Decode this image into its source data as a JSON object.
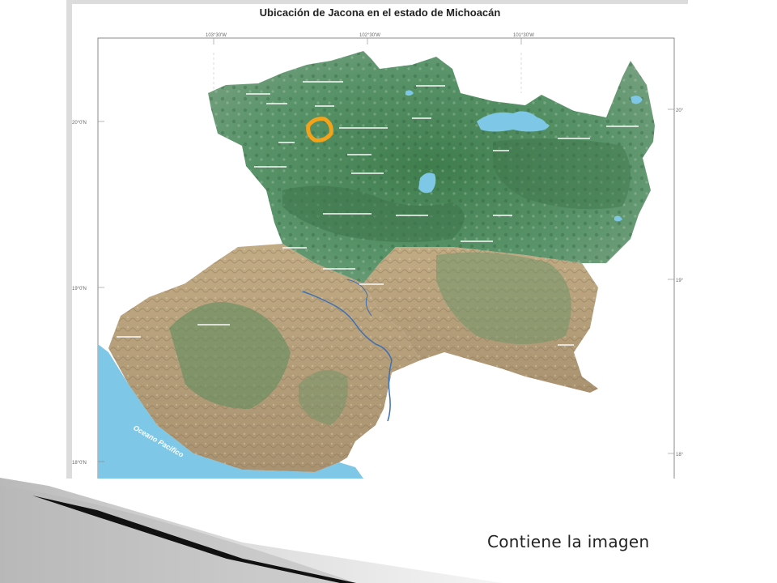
{
  "map": {
    "title": "Ubicación de Jacona en el estado de Michoacán",
    "ocean_label": "Oceano Pacifico",
    "top_ticks": [
      "103°30'W",
      "102°30'W",
      "101°30'W"
    ],
    "left_ticks": [
      "20°0'N",
      "19°0'N",
      "18°0'N"
    ],
    "right_ticks": [
      "20°",
      "19°",
      "18°"
    ],
    "colors": {
      "highland": "#4f8a5a",
      "lowland": "#b7a27c",
      "water": "#7ec7e6",
      "highlight": "#f2a31b",
      "river": "#3b6fb5"
    }
  },
  "caption": "Contiene la imagen"
}
